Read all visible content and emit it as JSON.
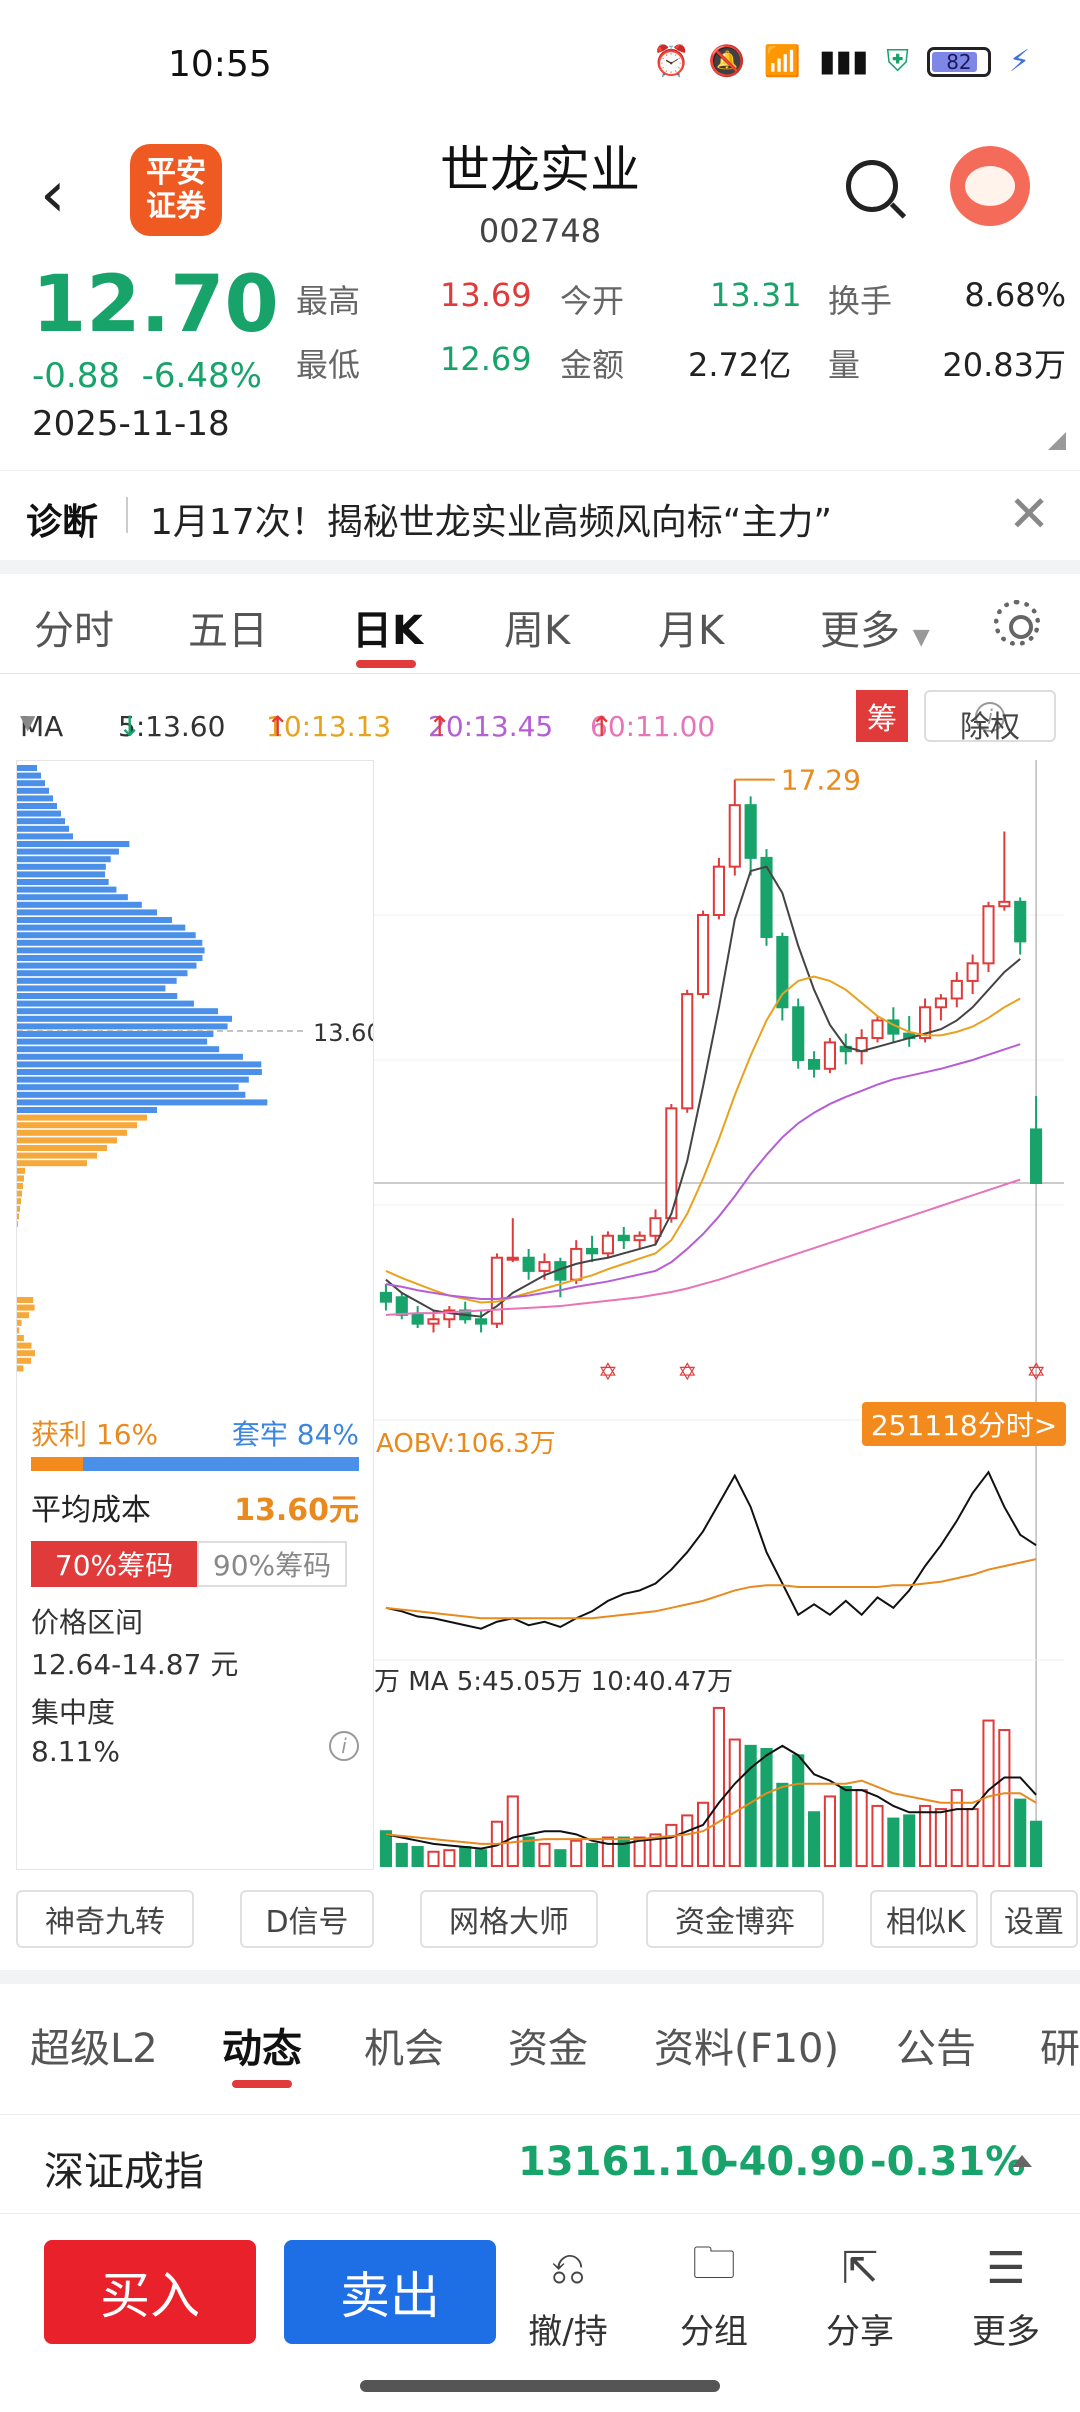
{
  "status": {
    "time": "10:55",
    "battery": "82"
  },
  "header": {
    "title": "世龙实业",
    "code": "002748",
    "logo_line1": "平安",
    "logo_line2": "证券"
  },
  "quote": {
    "price": "12.70",
    "change": "-0.88",
    "change_pct": "-6.48%",
    "date": "2025-11-18",
    "high_label": "最高",
    "high": "13.69",
    "open_label": "今开",
    "open": "13.31",
    "turnover_label": "换手",
    "turnover": "8.68%",
    "low_label": "最低",
    "low": "12.69",
    "amount_label": "金额",
    "amount": "2.72亿",
    "volume_label": "量",
    "volume": "20.83万"
  },
  "diagnosis": {
    "label": "诊断",
    "text": "1月17次！揭秘世龙实业高频风向标“主力”"
  },
  "ktabs": [
    "分时",
    "五日",
    "日K",
    "周K",
    "月K",
    "更多"
  ],
  "ma": {
    "label": "MA",
    "ma5": "5:13.60",
    "ma10": "10:13.13",
    "ma20": "20:13.45",
    "ma60": "60:11.00",
    "chip_btn": "筹",
    "exright": "除权"
  },
  "chip": {
    "profit": "获利 16%",
    "trapped": "套牢 84%",
    "profit_pct": 16,
    "avg_cost_label": "平均成本",
    "avg_cost": "13.60元",
    "toggle70": "70%筹码",
    "toggle90": "90%筹码",
    "price_range_label": "价格区间",
    "price_range": "12.64-14.87 元",
    "concentration_label": "集中度",
    "concentration": "8.11%",
    "avg_price_marker": "13.60"
  },
  "chart_data": {
    "type": "candlestick",
    "max_label": "17.29",
    "ohlc": [
      [
        11.45,
        11.55,
        11.25,
        11.35
      ],
      [
        11.4,
        11.45,
        11.15,
        11.2
      ],
      [
        11.2,
        11.3,
        11.05,
        11.1
      ],
      [
        11.1,
        11.25,
        11.0,
        11.15
      ],
      [
        11.15,
        11.3,
        11.05,
        11.25
      ],
      [
        11.25,
        11.35,
        11.1,
        11.15
      ],
      [
        11.15,
        11.25,
        11.0,
        11.1
      ],
      [
        11.1,
        11.9,
        11.05,
        11.85
      ],
      [
        11.85,
        12.3,
        11.8,
        11.85
      ],
      [
        11.85,
        11.95,
        11.6,
        11.7
      ],
      [
        11.7,
        11.9,
        11.6,
        11.8
      ],
      [
        11.8,
        11.85,
        11.4,
        11.6
      ],
      [
        11.6,
        12.05,
        11.55,
        11.95
      ],
      [
        11.95,
        12.1,
        11.8,
        11.9
      ],
      [
        11.9,
        12.15,
        11.85,
        12.1
      ],
      [
        12.1,
        12.2,
        11.95,
        12.05
      ],
      [
        12.05,
        12.15,
        11.95,
        12.1
      ],
      [
        12.1,
        12.4,
        12.0,
        12.3
      ],
      [
        12.3,
        13.6,
        12.25,
        13.55
      ],
      [
        13.55,
        14.9,
        13.5,
        14.85
      ],
      [
        14.85,
        15.8,
        14.8,
        15.75
      ],
      [
        15.75,
        16.4,
        15.7,
        16.3
      ],
      [
        16.3,
        17.29,
        16.2,
        17.0
      ],
      [
        17.0,
        17.1,
        16.2,
        16.4
      ],
      [
        16.4,
        16.5,
        15.4,
        15.5
      ],
      [
        15.5,
        15.55,
        14.55,
        14.7
      ],
      [
        14.7,
        14.8,
        14.0,
        14.1
      ],
      [
        14.1,
        14.2,
        13.9,
        14.0
      ],
      [
        14.0,
        14.35,
        13.95,
        14.3
      ],
      [
        14.25,
        14.4,
        14.05,
        14.2
      ],
      [
        14.2,
        14.45,
        14.05,
        14.35
      ],
      [
        14.35,
        14.6,
        14.3,
        14.55
      ],
      [
        14.55,
        14.7,
        14.3,
        14.4
      ],
      [
        14.4,
        14.6,
        14.25,
        14.35
      ],
      [
        14.35,
        14.8,
        14.3,
        14.7
      ],
      [
        14.7,
        14.85,
        14.55,
        14.8
      ],
      [
        14.8,
        15.1,
        14.7,
        15.0
      ],
      [
        15.0,
        15.3,
        14.85,
        15.2
      ],
      [
        15.2,
        15.9,
        15.1,
        15.85
      ],
      [
        15.85,
        16.7,
        15.8,
        15.9
      ],
      [
        15.9,
        15.95,
        15.3,
        15.45
      ],
      [
        13.31,
        13.69,
        12.69,
        12.7
      ]
    ],
    "ma_lines": {
      "ma5": [
        11.6,
        11.45,
        11.35,
        11.25,
        11.22,
        11.2,
        11.18,
        11.3,
        11.45,
        11.55,
        11.65,
        11.72,
        11.78,
        11.82,
        11.85,
        11.9,
        11.95,
        12.0,
        12.35,
        12.95,
        13.8,
        14.7,
        15.7,
        16.25,
        16.3,
        16.0,
        15.4,
        14.9,
        14.5,
        14.25,
        14.2,
        14.25,
        14.3,
        14.35,
        14.4,
        14.45,
        14.55,
        14.7,
        14.9,
        15.1,
        15.25,
        13.6
      ],
      "ma10": [
        11.7,
        11.62,
        11.55,
        11.48,
        11.42,
        11.38,
        11.34,
        11.35,
        11.4,
        11.45,
        11.5,
        11.55,
        11.6,
        11.65,
        11.72,
        11.78,
        11.84,
        11.9,
        12.05,
        12.35,
        12.75,
        13.2,
        13.7,
        14.15,
        14.55,
        14.85,
        15.0,
        15.05,
        15.0,
        14.9,
        14.75,
        14.6,
        14.5,
        14.42,
        14.38,
        14.38,
        14.42,
        14.48,
        14.58,
        14.7,
        14.8,
        13.13
      ],
      "ma20": [
        11.55,
        11.52,
        11.48,
        11.45,
        11.42,
        11.4,
        11.38,
        11.38,
        11.4,
        11.42,
        11.45,
        11.48,
        11.52,
        11.55,
        11.58,
        11.62,
        11.66,
        11.7,
        11.8,
        11.95,
        12.12,
        12.32,
        12.55,
        12.8,
        13.02,
        13.22,
        13.38,
        13.5,
        13.6,
        13.68,
        13.75,
        13.82,
        13.88,
        13.92,
        13.96,
        14.0,
        14.05,
        14.1,
        14.16,
        14.22,
        14.28,
        13.45
      ],
      "ma60": [
        11.2,
        11.21,
        11.22,
        11.22,
        11.23,
        11.24,
        11.25,
        11.26,
        11.27,
        11.28,
        11.29,
        11.3,
        11.32,
        11.34,
        11.36,
        11.38,
        11.4,
        11.43,
        11.46,
        11.5,
        11.55,
        11.6,
        11.66,
        11.72,
        11.78,
        11.84,
        11.9,
        11.96,
        12.02,
        12.08,
        12.14,
        12.2,
        12.26,
        12.32,
        12.38,
        12.44,
        12.5,
        12.56,
        12.62,
        12.68,
        12.74,
        11.0
      ]
    },
    "aobv_label": "AOBV:106.3万",
    "aobv": [
      0.3,
      0.28,
      0.25,
      0.24,
      0.22,
      0.2,
      0.18,
      0.22,
      0.24,
      0.2,
      0.22,
      0.19,
      0.24,
      0.28,
      0.34,
      0.38,
      0.4,
      0.44,
      0.52,
      0.62,
      0.74,
      0.9,
      1.06,
      0.88,
      0.62,
      0.44,
      0.26,
      0.32,
      0.26,
      0.34,
      0.26,
      0.36,
      0.3,
      0.4,
      0.54,
      0.66,
      0.8,
      0.96,
      1.08,
      0.88,
      0.72,
      0.66
    ],
    "aobv_ma": [
      0.3,
      0.29,
      0.28,
      0.27,
      0.26,
      0.25,
      0.24,
      0.24,
      0.24,
      0.24,
      0.24,
      0.24,
      0.24,
      0.24,
      0.25,
      0.26,
      0.27,
      0.28,
      0.3,
      0.32,
      0.34,
      0.37,
      0.4,
      0.42,
      0.43,
      0.43,
      0.42,
      0.42,
      0.42,
      0.42,
      0.42,
      0.42,
      0.43,
      0.43,
      0.44,
      0.45,
      0.47,
      0.49,
      0.52,
      0.54,
      0.56,
      0.58
    ],
    "vol_label": "万 MA 5:45.05万 10:40.47万",
    "volume": [
      22,
      14,
      12,
      9,
      10,
      12,
      10,
      28,
      44,
      18,
      14,
      10,
      16,
      14,
      18,
      18,
      18,
      20,
      26,
      32,
      40,
      100,
      80,
      76,
      74,
      52,
      70,
      34,
      44,
      50,
      48,
      38,
      30,
      32,
      38,
      36,
      48,
      36,
      92,
      86,
      42,
      28
    ],
    "vol_ma5": [
      20,
      18,
      16,
      14,
      13,
      12,
      11,
      13,
      18,
      20,
      22,
      22,
      20,
      16,
      14,
      14,
      16,
      17,
      18,
      22,
      26,
      40,
      52,
      62,
      70,
      76,
      70,
      58,
      54,
      48,
      48,
      44,
      38,
      34,
      34,
      34,
      36,
      36,
      48,
      56,
      56,
      45
    ],
    "vol_ma10": [
      20,
      19,
      18,
      17,
      16,
      15,
      14,
      14,
      15,
      16,
      17,
      17,
      17,
      17,
      17,
      17,
      17,
      18,
      19,
      20,
      22,
      28,
      34,
      40,
      46,
      50,
      52,
      52,
      52,
      52,
      54,
      50,
      46,
      44,
      42,
      40,
      40,
      40,
      44,
      46,
      46,
      40
    ]
  },
  "min_badge": "251118分时>",
  "tools": [
    "神奇九转",
    "D信号",
    "网格大师",
    "资金博弈",
    "相似K",
    "设置"
  ],
  "ntabs": [
    "超级L2",
    "动态",
    "机会",
    "资金",
    "资料(F10)",
    "公告",
    "研"
  ],
  "index": {
    "name": "深证成指",
    "value": "13161.10",
    "change": "-40.90",
    "pct": "-0.31%"
  },
  "bottom": {
    "buy": "买入",
    "sell": "卖出",
    "hold": "撤/持",
    "group": "分组",
    "share": "分享",
    "more": "更多"
  }
}
